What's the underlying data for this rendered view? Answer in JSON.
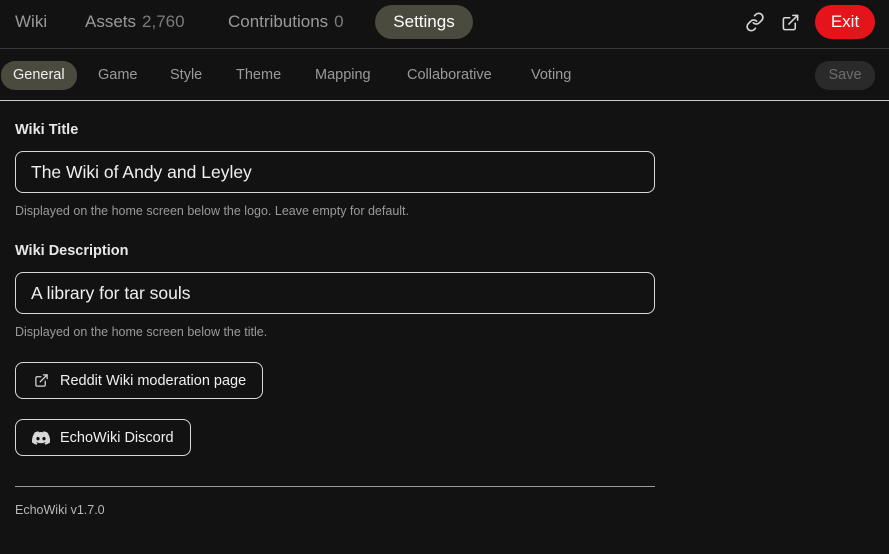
{
  "nav": {
    "wiki": "Wiki",
    "assets": "Assets",
    "assets_count": "2,760",
    "contributions": "Contributions",
    "contributions_count": "0",
    "settings": "Settings",
    "exit": "Exit"
  },
  "tabs": [
    {
      "label": "General",
      "active": true
    },
    {
      "label": "Game"
    },
    {
      "label": "Style"
    },
    {
      "label": "Theme"
    },
    {
      "label": "Mapping"
    },
    {
      "label": "Collaborative"
    },
    {
      "label": "Voting"
    }
  ],
  "save_label": "Save",
  "form": {
    "title_label": "Wiki Title",
    "title_value": "The Wiki of Andy and Leyley",
    "title_help": "Displayed on the home screen below the logo. Leave empty for default.",
    "description_label": "Wiki Description",
    "description_value": "A library for tar souls",
    "description_help": "Displayed on the home screen below the title."
  },
  "links": {
    "reddit": "Reddit Wiki moderation page",
    "discord": "EchoWiki Discord"
  },
  "version": "EchoWiki v1.7.0",
  "colors": {
    "background": "#121212",
    "accent_pill": "#4a4a3f",
    "exit": "#e5141b"
  },
  "icons": {
    "link": "link-icon",
    "external": "external-link-icon",
    "discord": "discord-icon"
  }
}
